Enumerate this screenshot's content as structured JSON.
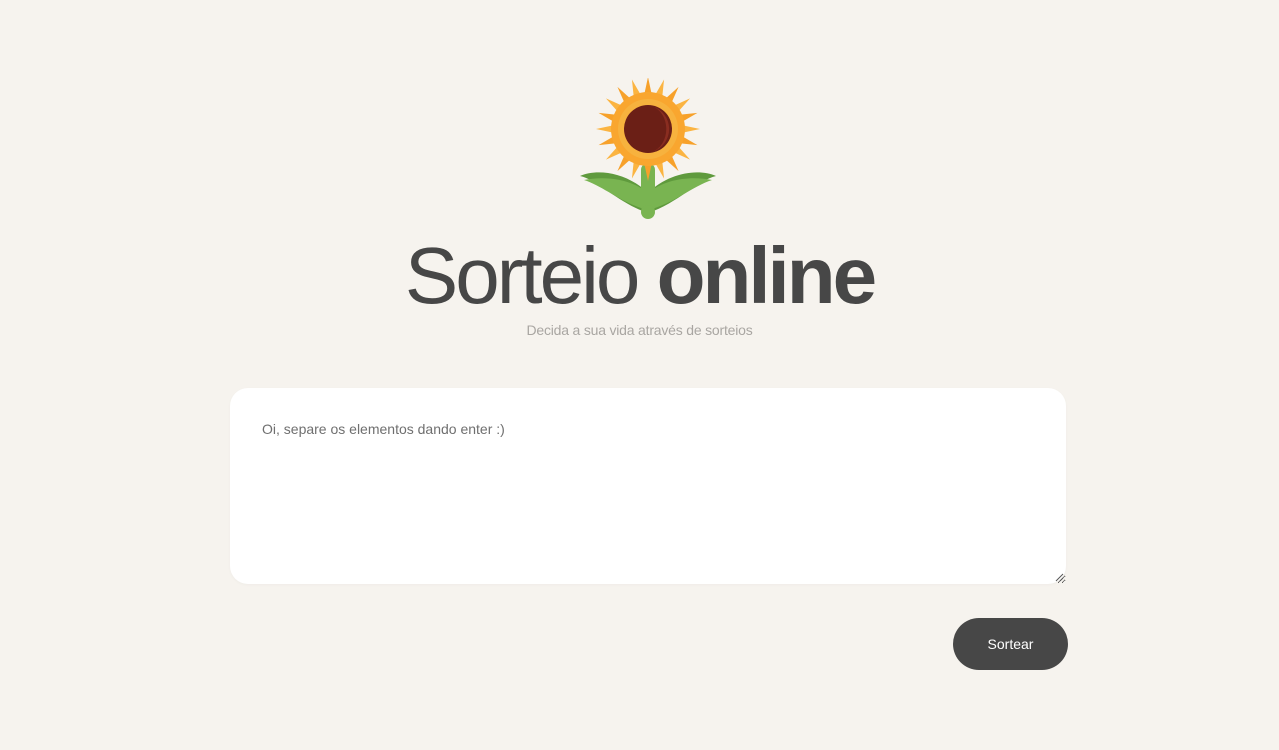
{
  "header": {
    "logo_icon": "sunflower-icon",
    "title_light": "Sorteio",
    "title_bold": "online",
    "subtitle": "Decida a sua vida através de sorteios"
  },
  "form": {
    "placeholder": "Oi, separe os elementos dando enter :)",
    "value": "",
    "submit_label": "Sortear"
  },
  "colors": {
    "background": "#f6f3ee",
    "text_dark": "#474747",
    "subtitle": "#a9a6a2",
    "button": "#474747",
    "petals": "#f9a62f",
    "center": "#6b1f16",
    "stem": "#79b451"
  }
}
